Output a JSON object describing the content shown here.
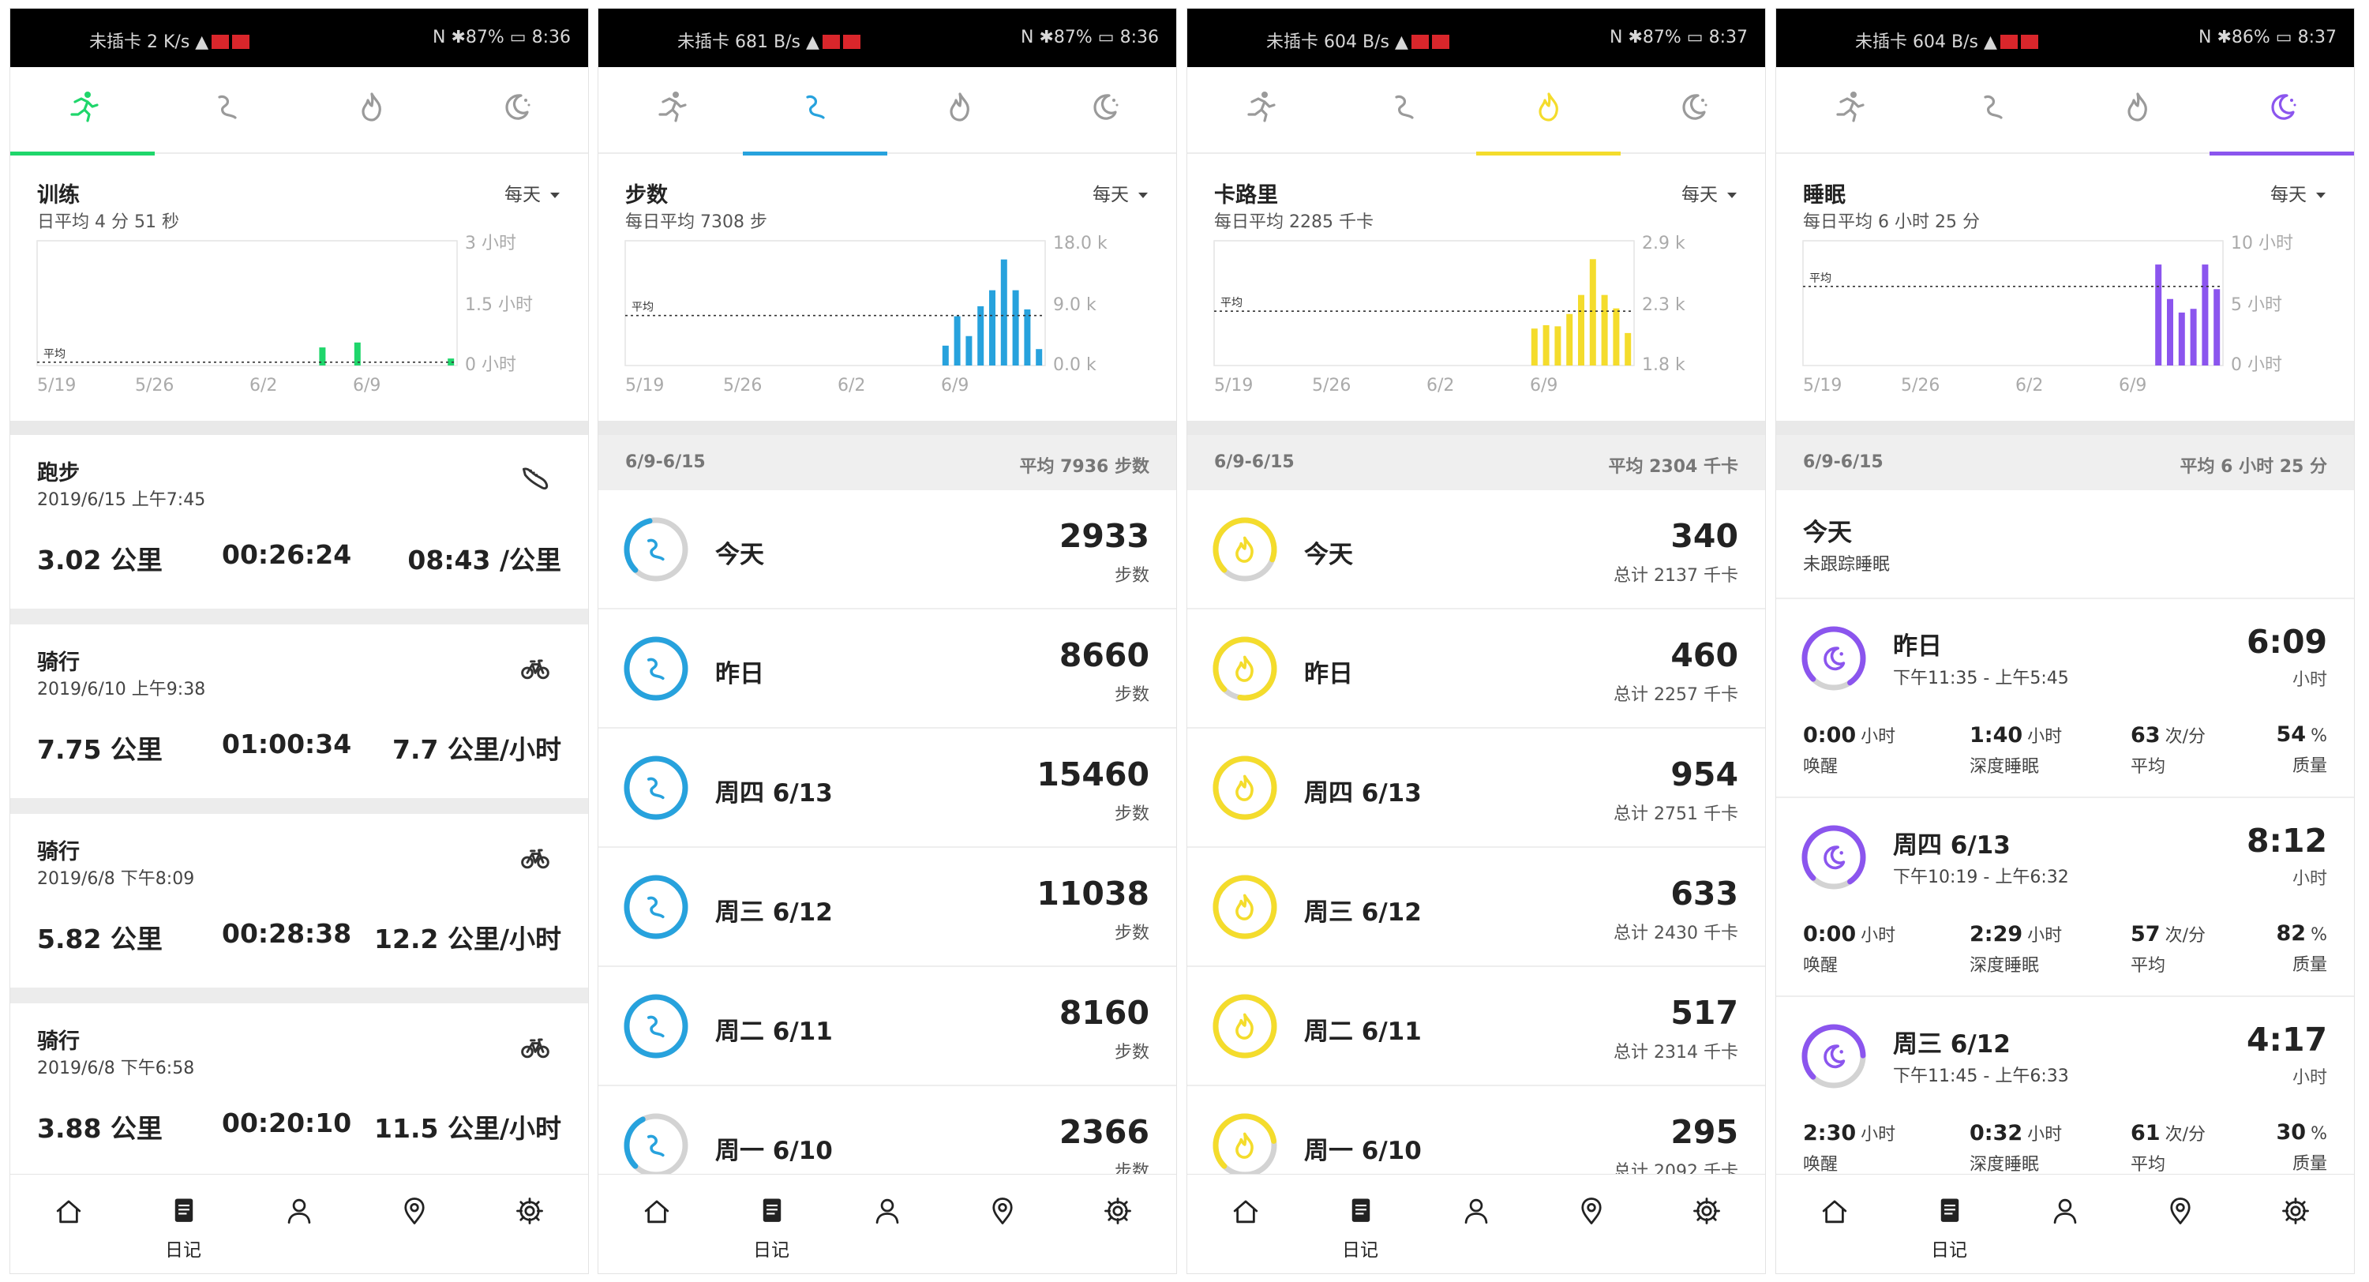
{
  "colors": {
    "workout": "#1fd66b",
    "steps": "#27a2dd",
    "calories": "#f4dc2c",
    "sleep": "#8b55ee",
    "ring_grey": "#d3d3d3",
    "text": "#222222"
  },
  "status_bars": [
    {
      "carrier": "未插卡",
      "net": "2\nK/s",
      "battery": "87%",
      "time": "8:36"
    },
    {
      "carrier": "未插卡",
      "net": "681\nB/s",
      "battery": "87%",
      "time": "8:36"
    },
    {
      "carrier": "未插卡",
      "net": "604\nB/s",
      "battery": "87%",
      "time": "8:37"
    },
    {
      "carrier": "未插卡",
      "net": "604\nB/s",
      "battery": "86%",
      "time": "8:37"
    }
  ],
  "tabs": [
    {
      "name": "workout",
      "icon": "running-icon"
    },
    {
      "name": "steps",
      "icon": "steps-icon"
    },
    {
      "name": "calories",
      "icon": "flame-icon"
    },
    {
      "name": "sleep",
      "icon": "moon-icon"
    }
  ],
  "period_label": "每天",
  "nav": [
    {
      "icon": "home-icon",
      "label": ""
    },
    {
      "icon": "diary-icon",
      "label": "日记"
    },
    {
      "icon": "profile-icon",
      "label": ""
    },
    {
      "icon": "map-pin-icon",
      "label": ""
    },
    {
      "icon": "gear-icon",
      "label": ""
    }
  ],
  "chart_data": [
    {
      "type": "bar",
      "title": "训练",
      "subtitle": "日平均 4 分 51 秒",
      "x_tick_labels": [
        "5/19",
        "5/26",
        "6/2",
        "6/9"
      ],
      "y_tick_labels": [
        "3 小时",
        "1.5 小时",
        "0 小时"
      ],
      "ylim": [
        0,
        3
      ],
      "avg_label": "平均",
      "avg_value": 0.08,
      "values": [
        0,
        0,
        0,
        0,
        0,
        0,
        0,
        0,
        0,
        0,
        0,
        0,
        0,
        0,
        0,
        0,
        0,
        0,
        0,
        0,
        0,
        0,
        0,
        0,
        0.44,
        0,
        0,
        0.56,
        0,
        0,
        0,
        0,
        0,
        0,
        0,
        0.17
      ],
      "color": "#1fd66b"
    },
    {
      "type": "bar",
      "title": "步数",
      "subtitle": "每日平均 7308 步",
      "x_tick_labels": [
        "5/19",
        "5/26",
        "6/2",
        "6/9"
      ],
      "y_tick_labels": [
        "18.0 k",
        "9.0 k",
        "0.0 k"
      ],
      "ylim": [
        0,
        18000
      ],
      "avg_label": "平均",
      "avg_value": 7308,
      "values": [
        0,
        0,
        0,
        0,
        0,
        0,
        0,
        0,
        0,
        0,
        0,
        0,
        0,
        0,
        0,
        0,
        0,
        0,
        0,
        0,
        0,
        0,
        0,
        0,
        0,
        2900,
        7200,
        4300,
        8660,
        11000,
        15500,
        11000,
        8200,
        2400
      ],
      "color": "#27a2dd"
    },
    {
      "type": "bar",
      "title": "卡路里",
      "subtitle": "每日平均 2285 千卡",
      "x_tick_labels": [
        "5/19",
        "5/26",
        "6/2",
        "6/9"
      ],
      "y_tick_labels": [
        "2.9 k",
        "2.3 k",
        "1.8 k"
      ],
      "ylim": [
        1800,
        2900
      ],
      "avg_label": "平均",
      "avg_value": 2285,
      "values": [
        0,
        0,
        0,
        0,
        0,
        0,
        0,
        0,
        0,
        0,
        0,
        0,
        0,
        0,
        0,
        0,
        0,
        0,
        0,
        0,
        0,
        0,
        0,
        0,
        0,
        2130,
        2160,
        2150,
        2260,
        2430,
        2750,
        2430,
        2310,
        2090
      ],
      "color": "#f4dc2c"
    },
    {
      "type": "bar",
      "title": "睡眠",
      "subtitle": "每日平均 6 小时 25 分",
      "x_tick_labels": [
        "5/19",
        "5/26",
        "6/2",
        "6/9"
      ],
      "y_tick_labels": [
        "10 小时",
        "5 小时",
        "0 小时"
      ],
      "ylim": [
        0,
        10
      ],
      "avg_label": "平均",
      "avg_value": 6.42,
      "values": [
        0,
        0,
        0,
        0,
        0,
        0,
        0,
        0,
        0,
        0,
        0,
        0,
        0,
        0,
        0,
        0,
        0,
        0,
        0,
        0,
        0,
        0,
        0,
        0,
        0,
        0,
        8.2,
        5.4,
        4.3,
        4.6,
        8.2,
        6.2
      ],
      "color": "#8b55ee"
    }
  ],
  "workouts": [
    {
      "title": "跑步",
      "date": "2019/6/15 上午7:45",
      "icon": "running-shoe-icon",
      "dist": "3.02 公里",
      "time": "00:26:24",
      "rate": "08:43 /公里"
    },
    {
      "title": "骑行",
      "date": "2019/6/10 上午9:38",
      "icon": "bicycle-icon",
      "dist": "7.75 公里",
      "time": "01:00:34",
      "rate": "7.7 公里/小时"
    },
    {
      "title": "骑行",
      "date": "2019/6/8 下午8:09",
      "icon": "bicycle-icon",
      "dist": "5.82 公里",
      "time": "00:28:38",
      "rate": "12.2 公里/小时"
    },
    {
      "title": "骑行",
      "date": "2019/6/8 下午6:58",
      "icon": "bicycle-icon",
      "dist": "3.88 公里",
      "time": "00:20:10",
      "rate": "11.5 公里/小时"
    }
  ],
  "steps_list": {
    "range": "6/9-6/15",
    "avg": "平均 7936 步数",
    "days": [
      {
        "label": "今天",
        "value": "2933",
        "unit": "步数",
        "ring_progress": 0.34
      },
      {
        "label": "昨日",
        "value": "8660",
        "unit": "步数",
        "ring_progress": 1.0
      },
      {
        "label": "周四 6/13",
        "value": "15460",
        "unit": "步数",
        "ring_progress": 1.0
      },
      {
        "label": "周三 6/12",
        "value": "11038",
        "unit": "步数",
        "ring_progress": 1.0
      },
      {
        "label": "周二 6/11",
        "value": "8160",
        "unit": "步数",
        "ring_progress": 1.0
      },
      {
        "label": "周一 6/10",
        "value": "2366",
        "unit": "步数",
        "ring_progress": 0.3
      }
    ]
  },
  "calories_list": {
    "range": "6/9-6/15",
    "avg": "平均 2304 千卡",
    "days": [
      {
        "label": "今天",
        "value": "340",
        "unit": "总计 2137 千卡",
        "ring_progress": 0.68
      },
      {
        "label": "昨日",
        "value": "460",
        "unit": "总计 2257 千卡",
        "ring_progress": 0.9
      },
      {
        "label": "周四 6/13",
        "value": "954",
        "unit": "总计 2751 千卡",
        "ring_progress": 1.0
      },
      {
        "label": "周三 6/12",
        "value": "633",
        "unit": "总计 2430 千卡",
        "ring_progress": 1.0
      },
      {
        "label": "周二 6/11",
        "value": "517",
        "unit": "总计 2314 千卡",
        "ring_progress": 1.0
      },
      {
        "label": "周一 6/10",
        "value": "295",
        "unit": "总计 2092 千卡",
        "ring_progress": 0.6
      }
    ]
  },
  "sleep_list": {
    "range": "6/9-6/15",
    "avg": "平均 6 小时 25 分",
    "today": {
      "label": "今天",
      "note": "未跟踪睡眠"
    },
    "nights": [
      {
        "day": "昨日",
        "range": "下午11:35 - 上午5:45",
        "dur": "6:09",
        "dur_unit": "小时",
        "ring_progress": 0.78,
        "stats": [
          {
            "v": "0:00",
            "u": "小时",
            "l": "唤醒"
          },
          {
            "v": "1:40",
            "u": "小时",
            "l": "深度睡眠"
          },
          {
            "v": "63",
            "u": "次/分",
            "l": "平均"
          },
          {
            "v": "54",
            "u": "%",
            "l": "质量"
          }
        ]
      },
      {
        "day": "周四 6/13",
        "range": "下午10:19 - 上午6:32",
        "dur": "8:12",
        "dur_unit": "小时",
        "ring_progress": 0.78,
        "stats": [
          {
            "v": "0:00",
            "u": "小时",
            "l": "唤醒"
          },
          {
            "v": "2:29",
            "u": "小时",
            "l": "深度睡眠"
          },
          {
            "v": "57",
            "u": "次/分",
            "l": "平均"
          },
          {
            "v": "82",
            "u": "%",
            "l": "质量"
          }
        ]
      },
      {
        "day": "周三 6/12",
        "range": "下午11:45 - 上午6:33",
        "dur": "4:17",
        "dur_unit": "小时",
        "ring_progress": 0.62,
        "stats": [
          {
            "v": "2:30",
            "u": "小时",
            "l": "唤醒"
          },
          {
            "v": "0:32",
            "u": "小时",
            "l": "深度睡眠"
          },
          {
            "v": "61",
            "u": "次/分",
            "l": "平均"
          },
          {
            "v": "30",
            "u": "%",
            "l": "质量"
          }
        ]
      }
    ]
  }
}
